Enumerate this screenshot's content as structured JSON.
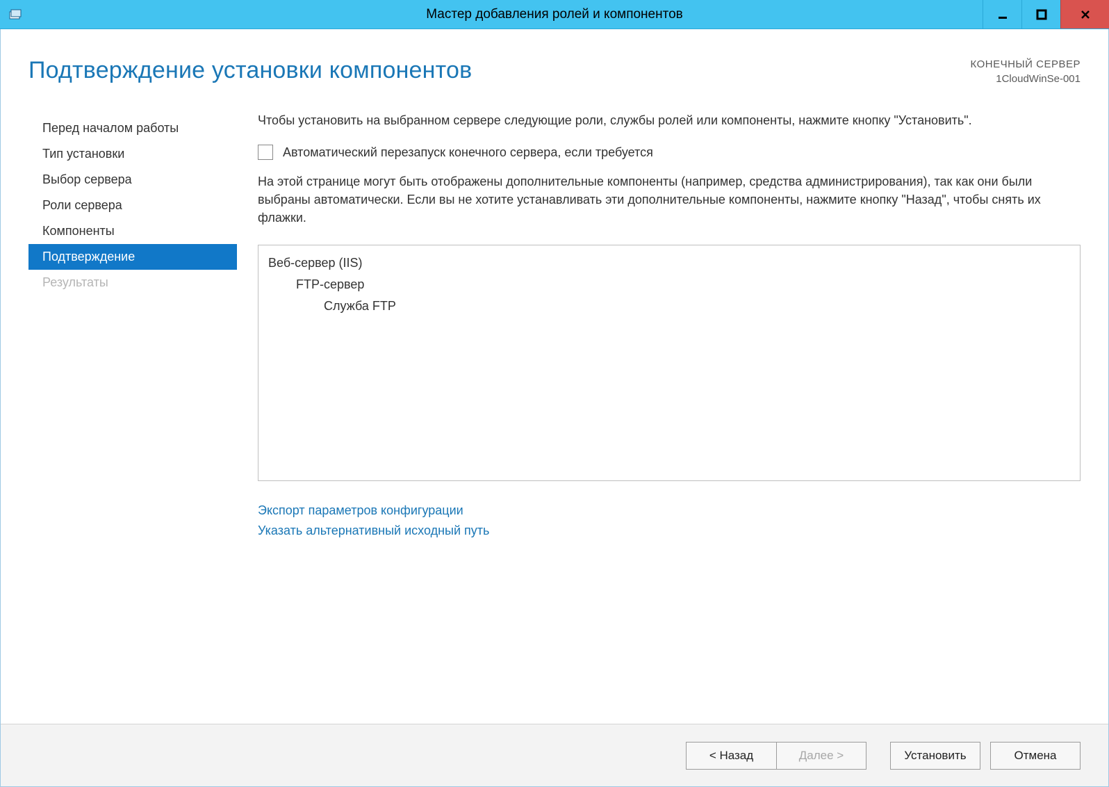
{
  "window": {
    "title": "Мастер добавления ролей и компонентов"
  },
  "header": {
    "page_title": "Подтверждение установки компонентов",
    "server_label": "КОНЕЧНЫЙ СЕРВЕР",
    "server_name": "1CloudWinSe-001"
  },
  "sidebar": {
    "steps": [
      {
        "label": "Перед началом работы",
        "state": "past"
      },
      {
        "label": "Тип установки",
        "state": "past"
      },
      {
        "label": "Выбор сервера",
        "state": "past"
      },
      {
        "label": "Роли сервера",
        "state": "past"
      },
      {
        "label": "Компоненты",
        "state": "past"
      },
      {
        "label": "Подтверждение",
        "state": "active"
      },
      {
        "label": "Результаты",
        "state": "future"
      }
    ]
  },
  "main": {
    "instruction": "Чтобы установить на выбранном сервере следующие роли, службы ролей или компоненты, нажмите кнопку \"Установить\".",
    "restart_checkbox_label": "Автоматический перезапуск конечного сервера, если требуется",
    "restart_checked": false,
    "note": "На этой странице могут быть отображены дополнительные компоненты (например, средства администрирования), так как они были выбраны автоматически. Если вы не хотите устанавливать эти дополнительные компоненты, нажмите кнопку \"Назад\", чтобы снять их флажки.",
    "tree": {
      "lvl1": "Веб-сервер (IIS)",
      "lvl2": "FTP-сервер",
      "lvl3": "Служба FTP"
    },
    "links": {
      "export": "Экспорт параметров конфигурации",
      "alt_path": "Указать альтернативный исходный путь"
    }
  },
  "footer": {
    "back": "< Назад",
    "next": "Далее >",
    "install": "Установить",
    "cancel": "Отмена"
  }
}
